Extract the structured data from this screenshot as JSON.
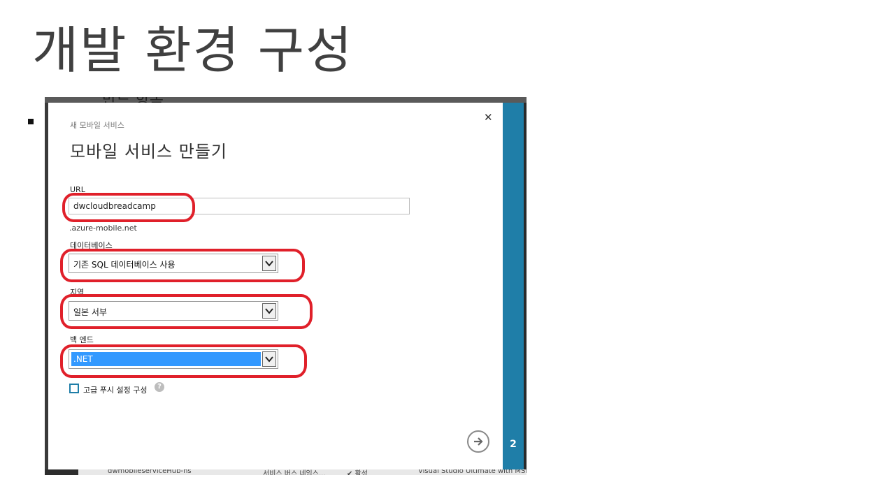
{
  "slide": {
    "title": "개발 환경 구성"
  },
  "background": {
    "peek_title": "만드 항목",
    "bottom_row": [
      "dwmobileserviceHub-ns",
      "서비스 버스 네임스...",
      "✔ 활성",
      "Visual Studio Ultimate with MSD"
    ]
  },
  "dialog": {
    "subtitle": "새 모바일 서비스",
    "heading": "모바일 서비스 만들기",
    "close_icon": "close-icon",
    "url": {
      "label": "URL",
      "value": "dwcloudbreadcamp",
      "suffix": ".azure-mobile.net"
    },
    "database": {
      "label": "데이터베이스",
      "selected": "기존 SQL 데이터베이스 사용"
    },
    "region": {
      "label": "지역",
      "selected": "일본 서부"
    },
    "backend": {
      "label": "백 엔드",
      "selected": ".NET"
    },
    "push": {
      "label": "고급 푸시 설정 구성",
      "checked": false,
      "help": "?"
    },
    "next_icon": "arrow-right-icon",
    "step": "2"
  },
  "colors": {
    "accent": "#1f7ea8",
    "annotation": "#e0202a",
    "selection": "#3399ff"
  }
}
